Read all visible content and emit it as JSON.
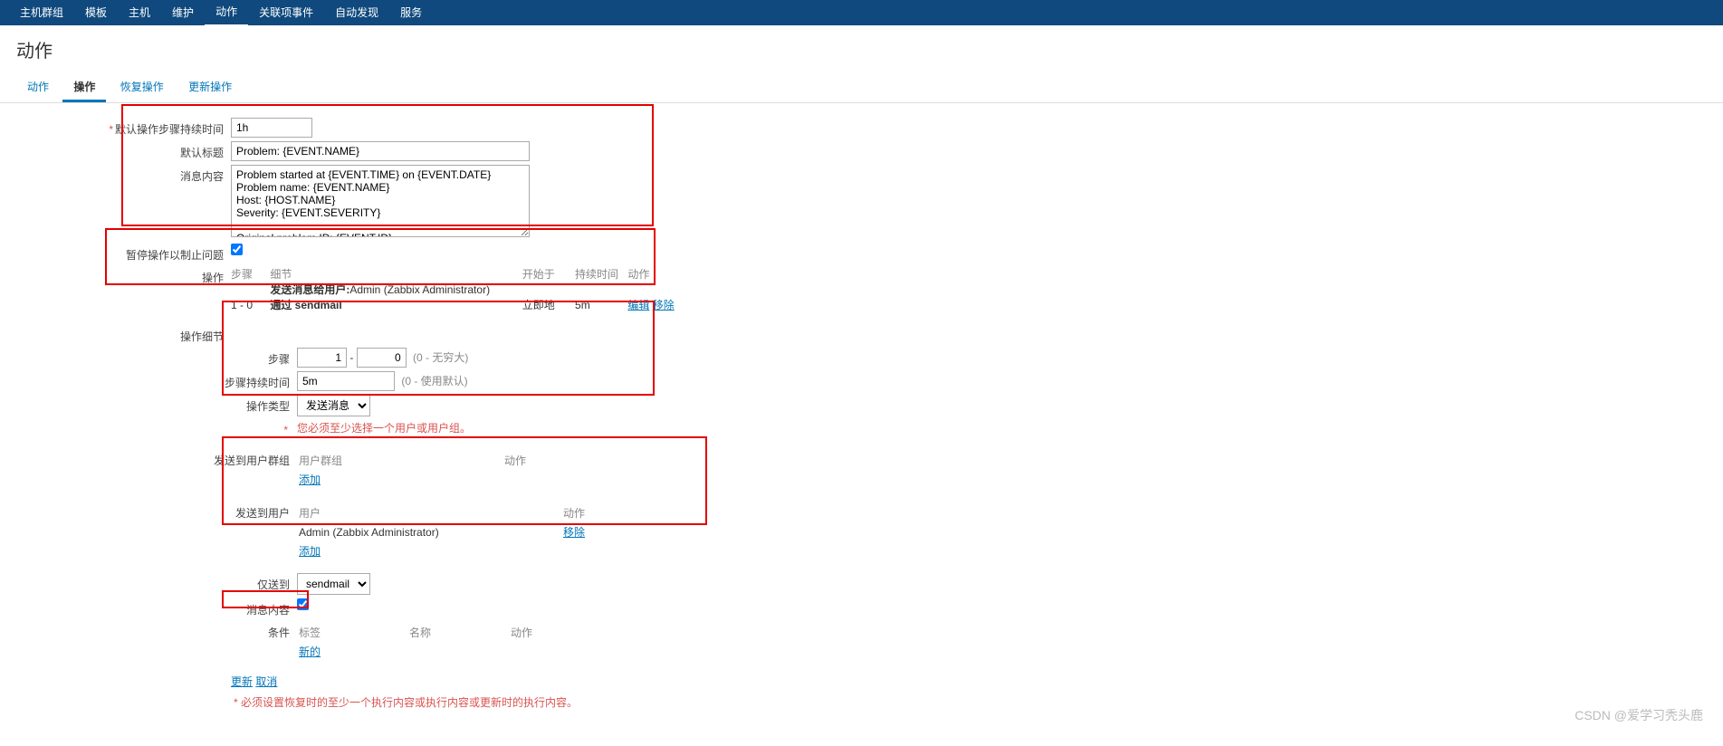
{
  "topnav": {
    "items": [
      "主机群组",
      "模板",
      "主机",
      "维护",
      "动作",
      "关联项事件",
      "自动发现",
      "服务"
    ],
    "active_index": 4
  },
  "page_title": "动作",
  "tabs": {
    "items": [
      "动作",
      "操作",
      "恢复操作",
      "更新操作"
    ],
    "active_index": 1
  },
  "form": {
    "default_step_duration": {
      "label": "默认操作步骤持续时间",
      "value": "1h"
    },
    "default_subject": {
      "label": "默认标题",
      "value": "Problem: {EVENT.NAME}"
    },
    "message": {
      "label": "消息内容",
      "value": "Problem started at {EVENT.TIME} on {EVENT.DATE}\nProblem name: {EVENT.NAME}\nHost: {HOST.NAME}\nSeverity: {EVENT.SEVERITY}\n\nOriginal problem ID: {EVENT.ID}\n{TRIGGER.URL}"
    },
    "pause_ops": {
      "label": "暂停操作以制止问题"
    },
    "ops_label": "操作",
    "ops_table": {
      "headers": {
        "steps": "步骤",
        "detail": "细节",
        "start": "开始于",
        "duration": "持续时间",
        "action": "动作"
      },
      "row": {
        "steps": "1 - 0",
        "detail_prefix": "发送消息给用户: ",
        "detail_user": "Admin (Zabbix Administrator)",
        "detail_via": " 通过 sendmail",
        "start": "立即地",
        "duration": "5m",
        "edit": "编辑",
        "remove": "移除"
      }
    }
  },
  "op_details": {
    "section_label": "操作细节",
    "step_label": "步骤",
    "step_from": "1",
    "step_to": "0",
    "step_hint": "(0 - 无穷大)",
    "step_duration_label": "步骤持续时间",
    "step_duration_value": "5m",
    "step_duration_hint": "(0 - 使用默认)",
    "op_type_label": "操作类型",
    "op_type_value": "发送消息",
    "warn": "您必须至少选择一个用户或用户组。",
    "send_groups_label": "发送到用户群组",
    "send_groups_headers": {
      "group": "用户群组",
      "action": "动作"
    },
    "add_link": "添加",
    "send_users_label": "发送到用户",
    "send_users_headers": {
      "user": "用户",
      "action": "动作"
    },
    "send_users_row": {
      "user": "Admin (Zabbix Administrator)",
      "remove": "移除"
    },
    "send_only_label": "仅送到",
    "send_only_value": "sendmail",
    "msg_content_label": "消息内容",
    "conditions_label": "条件",
    "conditions_headers": {
      "tag": "标签",
      "name": "名称",
      "action": "动作"
    },
    "new_link": "新的",
    "update_btn": "更新",
    "cancel_btn": "取消",
    "footer_note": "必须设置恢复时的至少一个执行内容或执行内容或更新时的执行内容。"
  },
  "watermark": "CSDN @爱学习秃头鹿"
}
